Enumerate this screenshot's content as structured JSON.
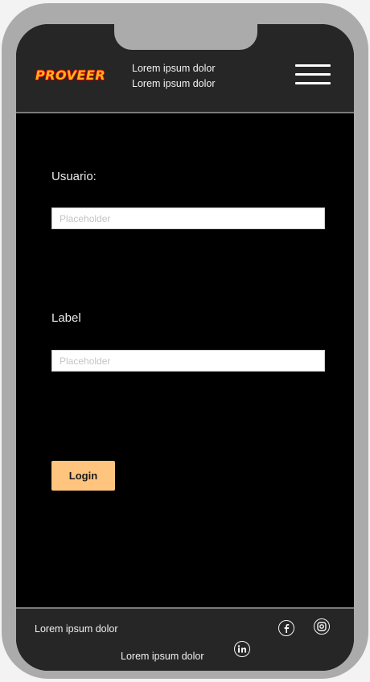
{
  "header": {
    "logo_text": "PROVEER",
    "lines": [
      "Lorem ipsum dolor",
      "Lorem ipsum dolor"
    ],
    "menu_icon": "hamburger-menu-icon"
  },
  "form": {
    "fields": [
      {
        "label": "Usuario:",
        "placeholder": "Placeholder"
      },
      {
        "label": "Label",
        "placeholder": "Placeholder"
      }
    ],
    "login_label": "Login"
  },
  "footer": {
    "text_1": "Lorem ipsum dolor",
    "text_2": "Lorem ipsum dolor",
    "social_icons": [
      "facebook-icon",
      "instagram-icon",
      "linkedin-icon"
    ]
  },
  "colors": {
    "logo": "#ffb21c",
    "logo_outline": "#d60000",
    "button": "#ffc47d",
    "bar_background": "#262626",
    "screen_background": "#000000",
    "device_frame": "#ababab"
  }
}
